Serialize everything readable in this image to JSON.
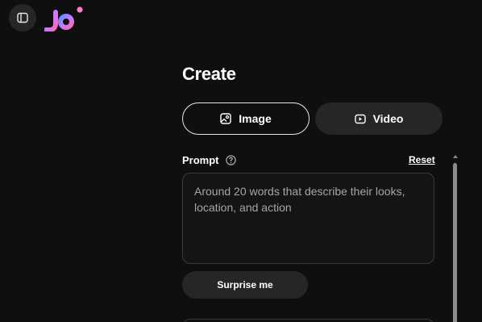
{
  "header": {
    "sidebar_toggle_icon": "sidebar-toggle-icon",
    "logo_text": "joi",
    "logo_colors": [
      "#4f7bff",
      "#c86bff",
      "#ff5fb8"
    ]
  },
  "create": {
    "title": "Create",
    "modes": [
      {
        "label": "Image",
        "icon": "image-icon",
        "selected": true
      },
      {
        "label": "Video",
        "icon": "video-icon",
        "selected": false
      }
    ],
    "prompt": {
      "label": "Prompt",
      "help_icon": "help-circle-icon",
      "reset_label": "Reset",
      "placeholder": "Around 20 words that describe their looks, location, and action",
      "value": ""
    },
    "surprise_label": "Surprise me"
  }
}
